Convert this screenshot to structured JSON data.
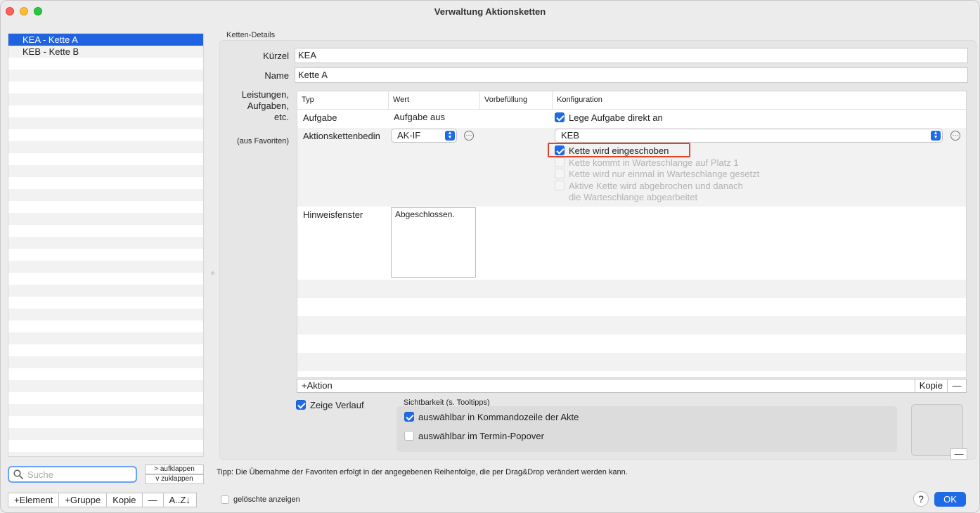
{
  "window": {
    "title": "Verwaltung Aktionsketten"
  },
  "list": {
    "items": [
      {
        "label": "KEA - Kette A",
        "selected": true
      },
      {
        "label": "KEB - Kette B",
        "selected": false
      }
    ]
  },
  "search": {
    "placeholder": "Suche"
  },
  "expand": {
    "open_label": "> aufklappen",
    "close_label": "v  zuklappen"
  },
  "list_toolbar": {
    "add_element": "+Element",
    "add_group": "+Gruppe",
    "copy": "Kopie",
    "remove": "—",
    "sort": "A..Z↓"
  },
  "details": {
    "group_title": "Ketten-Details",
    "kuerzel_label": "Kürzel",
    "kuerzel_value": "KEA",
    "name_label": "Name",
    "name_value": "Kette A",
    "leistungen_label": "Leistungen,\nAufgaben,\netc.",
    "favoriten_label": "(aus Favoriten)"
  },
  "table": {
    "headers": [
      "Typ",
      "Wert",
      "Vorbefüllung",
      "Konfiguration"
    ],
    "row1": {
      "typ": "Aufgabe",
      "wert": "Aufgabe aus",
      "config_checkbox": "Lege Aufgabe direkt an",
      "checked": true
    },
    "row2": {
      "typ": "Aktionskettenbedin",
      "wert_select": "AK-IF",
      "config_select": "KEB",
      "options": [
        {
          "label": "Kette wird eingeschoben",
          "checked": true,
          "enabled": true
        },
        {
          "label": "Kette kommt in Warteschlange auf Platz 1",
          "checked": false,
          "enabled": false
        },
        {
          "label": "Kette wird nur einmal in Warteschlange gesetzt",
          "checked": false,
          "enabled": false
        },
        {
          "label": "Aktive Kette wird abgebrochen und danach\ndie Warteschlange abgearbeitet",
          "checked": false,
          "enabled": false
        }
      ]
    },
    "row3": {
      "typ": "Hinweisfenster",
      "text": "Abgeschlossen."
    }
  },
  "table_toolbar": {
    "add_action": "+Aktion",
    "copy": "Kopie",
    "remove": "—"
  },
  "verlauf": {
    "label": "Zeige Verlauf",
    "checked": true
  },
  "sichtbarkeit": {
    "title": "Sichtbarkeit (s. Tooltipps)",
    "opt1": {
      "label": "auswählbar in Kommandozeile der Akte",
      "checked": true
    },
    "opt2": {
      "label": "auswählbar im Termin-Popover",
      "checked": false
    }
  },
  "preview_remove": "—",
  "hint": "Tipp: Die Übernahme der Favoriten erfolgt in der angegebenen Reihenfolge, die per Drag&Drop verändert werden kann.",
  "deleted": {
    "label": "gelöschte anzeigen",
    "checked": false
  },
  "footer": {
    "help": "?",
    "ok": "OK"
  },
  "colors": {
    "accent": "#1f6be6",
    "highlight": "#e5432c",
    "selection": "#1f63e0"
  }
}
